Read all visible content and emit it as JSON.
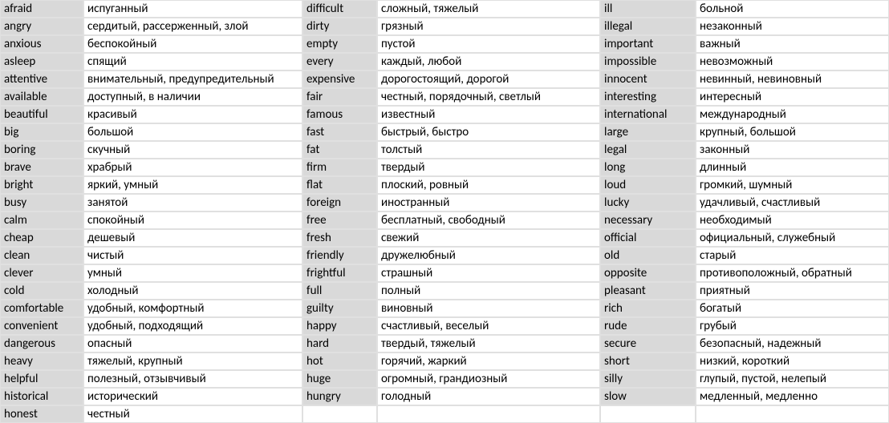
{
  "columns": [
    {
      "en_key": "col1_en",
      "ru_key": "col1_ru"
    },
    {
      "en_key": "col2_en",
      "ru_key": "col2_ru"
    },
    {
      "en_key": "col3_en",
      "ru_key": "col3_ru"
    }
  ],
  "rows": [
    {
      "col1_en": "afraid",
      "col1_ru": "испуганный",
      "col2_en": "difficult",
      "col2_ru": "сложный, тяжелый",
      "col3_en": "ill",
      "col3_ru": "больной"
    },
    {
      "col1_en": "angry",
      "col1_ru": "сердитый, рассерженный, злой",
      "col2_en": "dirty",
      "col2_ru": "грязный",
      "col3_en": "illegal",
      "col3_ru": "незаконный"
    },
    {
      "col1_en": "anxious",
      "col1_ru": "беспокойный",
      "col2_en": "empty",
      "col2_ru": "пустой",
      "col3_en": "important",
      "col3_ru": "важный"
    },
    {
      "col1_en": "asleep",
      "col1_ru": "спящий",
      "col2_en": "every",
      "col2_ru": "каждый, любой",
      "col3_en": "impossible",
      "col3_ru": "невозможный"
    },
    {
      "col1_en": "attentive",
      "col1_ru": "внимательный, предупредительный",
      "col2_en": "expensive",
      "col2_ru": "дорогостоящий, дорогой",
      "col3_en": "innocent",
      "col3_ru": "невинный, невиновный"
    },
    {
      "col1_en": "available",
      "col1_ru": "доступный, в наличии",
      "col2_en": "fair",
      "col2_ru": "честный, порядочный, светлый",
      "col3_en": "interesting",
      "col3_ru": "интересный"
    },
    {
      "col1_en": "beautiful",
      "col1_ru": "красивый",
      "col2_en": "famous",
      "col2_ru": "известный",
      "col3_en": "international",
      "col3_ru": "международный"
    },
    {
      "col1_en": "big",
      "col1_ru": "большой",
      "col2_en": "fast",
      "col2_ru": "быстрый, быстро",
      "col3_en": "large",
      "col3_ru": "крупный, большой"
    },
    {
      "col1_en": "boring",
      "col1_ru": "скучный",
      "col2_en": "fat",
      "col2_ru": "толстый",
      "col3_en": "legal",
      "col3_ru": "законный"
    },
    {
      "col1_en": "brave",
      "col1_ru": "храбрый",
      "col2_en": "firm",
      "col2_ru": "твердый",
      "col3_en": "long",
      "col3_ru": "длинный"
    },
    {
      "col1_en": "bright",
      "col1_ru": "яркий, умный",
      "col2_en": "flat",
      "col2_ru": "плоский, ровный",
      "col3_en": "loud",
      "col3_ru": "громкий, шумный"
    },
    {
      "col1_en": "busy",
      "col1_ru": "занятой",
      "col2_en": "foreign",
      "col2_ru": "иностранный",
      "col3_en": "lucky",
      "col3_ru": "удачливый, счастливый"
    },
    {
      "col1_en": "calm",
      "col1_ru": "спокойный",
      "col2_en": "free",
      "col2_ru": "бесплатный, свободный",
      "col3_en": "necessary",
      "col3_ru": "необходимый"
    },
    {
      "col1_en": "cheap",
      "col1_ru": "дешевый",
      "col2_en": "fresh",
      "col2_ru": "свежий",
      "col3_en": "official",
      "col3_ru": "официальный, служебный"
    },
    {
      "col1_en": "clean",
      "col1_ru": "чистый",
      "col2_en": "friendly",
      "col2_ru": "дружелюбный",
      "col3_en": "old",
      "col3_ru": "старый"
    },
    {
      "col1_en": "clever",
      "col1_ru": "умный",
      "col2_en": "frightful",
      "col2_ru": "страшный",
      "col3_en": "opposite",
      "col3_ru": "противоположный, обратный"
    },
    {
      "col1_en": "cold",
      "col1_ru": "холодный",
      "col2_en": "full",
      "col2_ru": "полный",
      "col3_en": "pleasant",
      "col3_ru": "приятный"
    },
    {
      "col1_en": "comfortable",
      "col1_ru": "удобный, комфортный",
      "col2_en": "guilty",
      "col2_ru": "виновный",
      "col3_en": "rich",
      "col3_ru": "богатый"
    },
    {
      "col1_en": "convenient",
      "col1_ru": "удобный, подходящий",
      "col2_en": "happy",
      "col2_ru": "счастливый, веселый",
      "col3_en": "rude",
      "col3_ru": "грубый"
    },
    {
      "col1_en": "dangerous",
      "col1_ru": "опасный",
      "col2_en": "hard",
      "col2_ru": "твердый, тяжелый",
      "col3_en": "secure",
      "col3_ru": "безопасный, надежный"
    },
    {
      "col1_en": "heavy",
      "col1_ru": "тяжелый, крупный",
      "col2_en": "hot",
      "col2_ru": "горячий, жаркий",
      "col3_en": "short",
      "col3_ru": "низкий, короткий"
    },
    {
      "col1_en": "helpful",
      "col1_ru": "полезный, отзывчивый",
      "col2_en": "huge",
      "col2_ru": "огромный, грандиозный",
      "col3_en": "silly",
      "col3_ru": "глупый, пустой, нелепый"
    },
    {
      "col1_en": "historical",
      "col1_ru": "исторический",
      "col2_en": "hungry",
      "col2_ru": "голодный",
      "col3_en": "slow",
      "col3_ru": "медленный, медленно"
    },
    {
      "col1_en": "honest",
      "col1_ru": "честный",
      "col2_en": "",
      "col2_ru": "",
      "col3_en": "",
      "col3_ru": ""
    }
  ]
}
